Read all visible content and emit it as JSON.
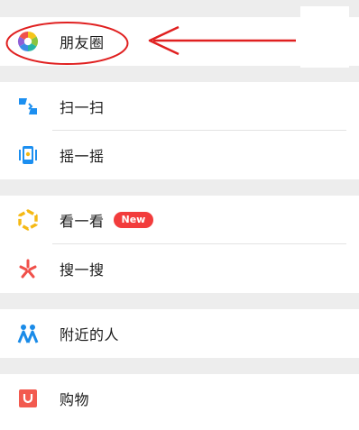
{
  "menu": {
    "moments": {
      "label": "朋友圈",
      "icon": "moments-aperture-icon"
    },
    "scan": {
      "label": "扫一扫",
      "icon": "scan-icon"
    },
    "shake": {
      "label": "摇一摇",
      "icon": "shake-phone-icon"
    },
    "top_stories": {
      "label": "看一看",
      "icon": "top-stories-icon",
      "badge": "New"
    },
    "search": {
      "label": "搜一搜",
      "icon": "search-star-icon"
    },
    "nearby": {
      "label": "附近的人",
      "icon": "people-nearby-icon"
    },
    "shopping": {
      "label": "购物",
      "icon": "shopping-bag-icon"
    }
  },
  "colors": {
    "background": "#ededed",
    "card": "#ffffff",
    "badge": "#f23c3c",
    "annotation": "#e02020",
    "scan_icon": "#1c8ff0",
    "top_stories_icon": "#f5b914",
    "search_icon": "#f0504a",
    "nearby_icon": "#1a8be8",
    "shopping_icon": "#f25a4f"
  }
}
